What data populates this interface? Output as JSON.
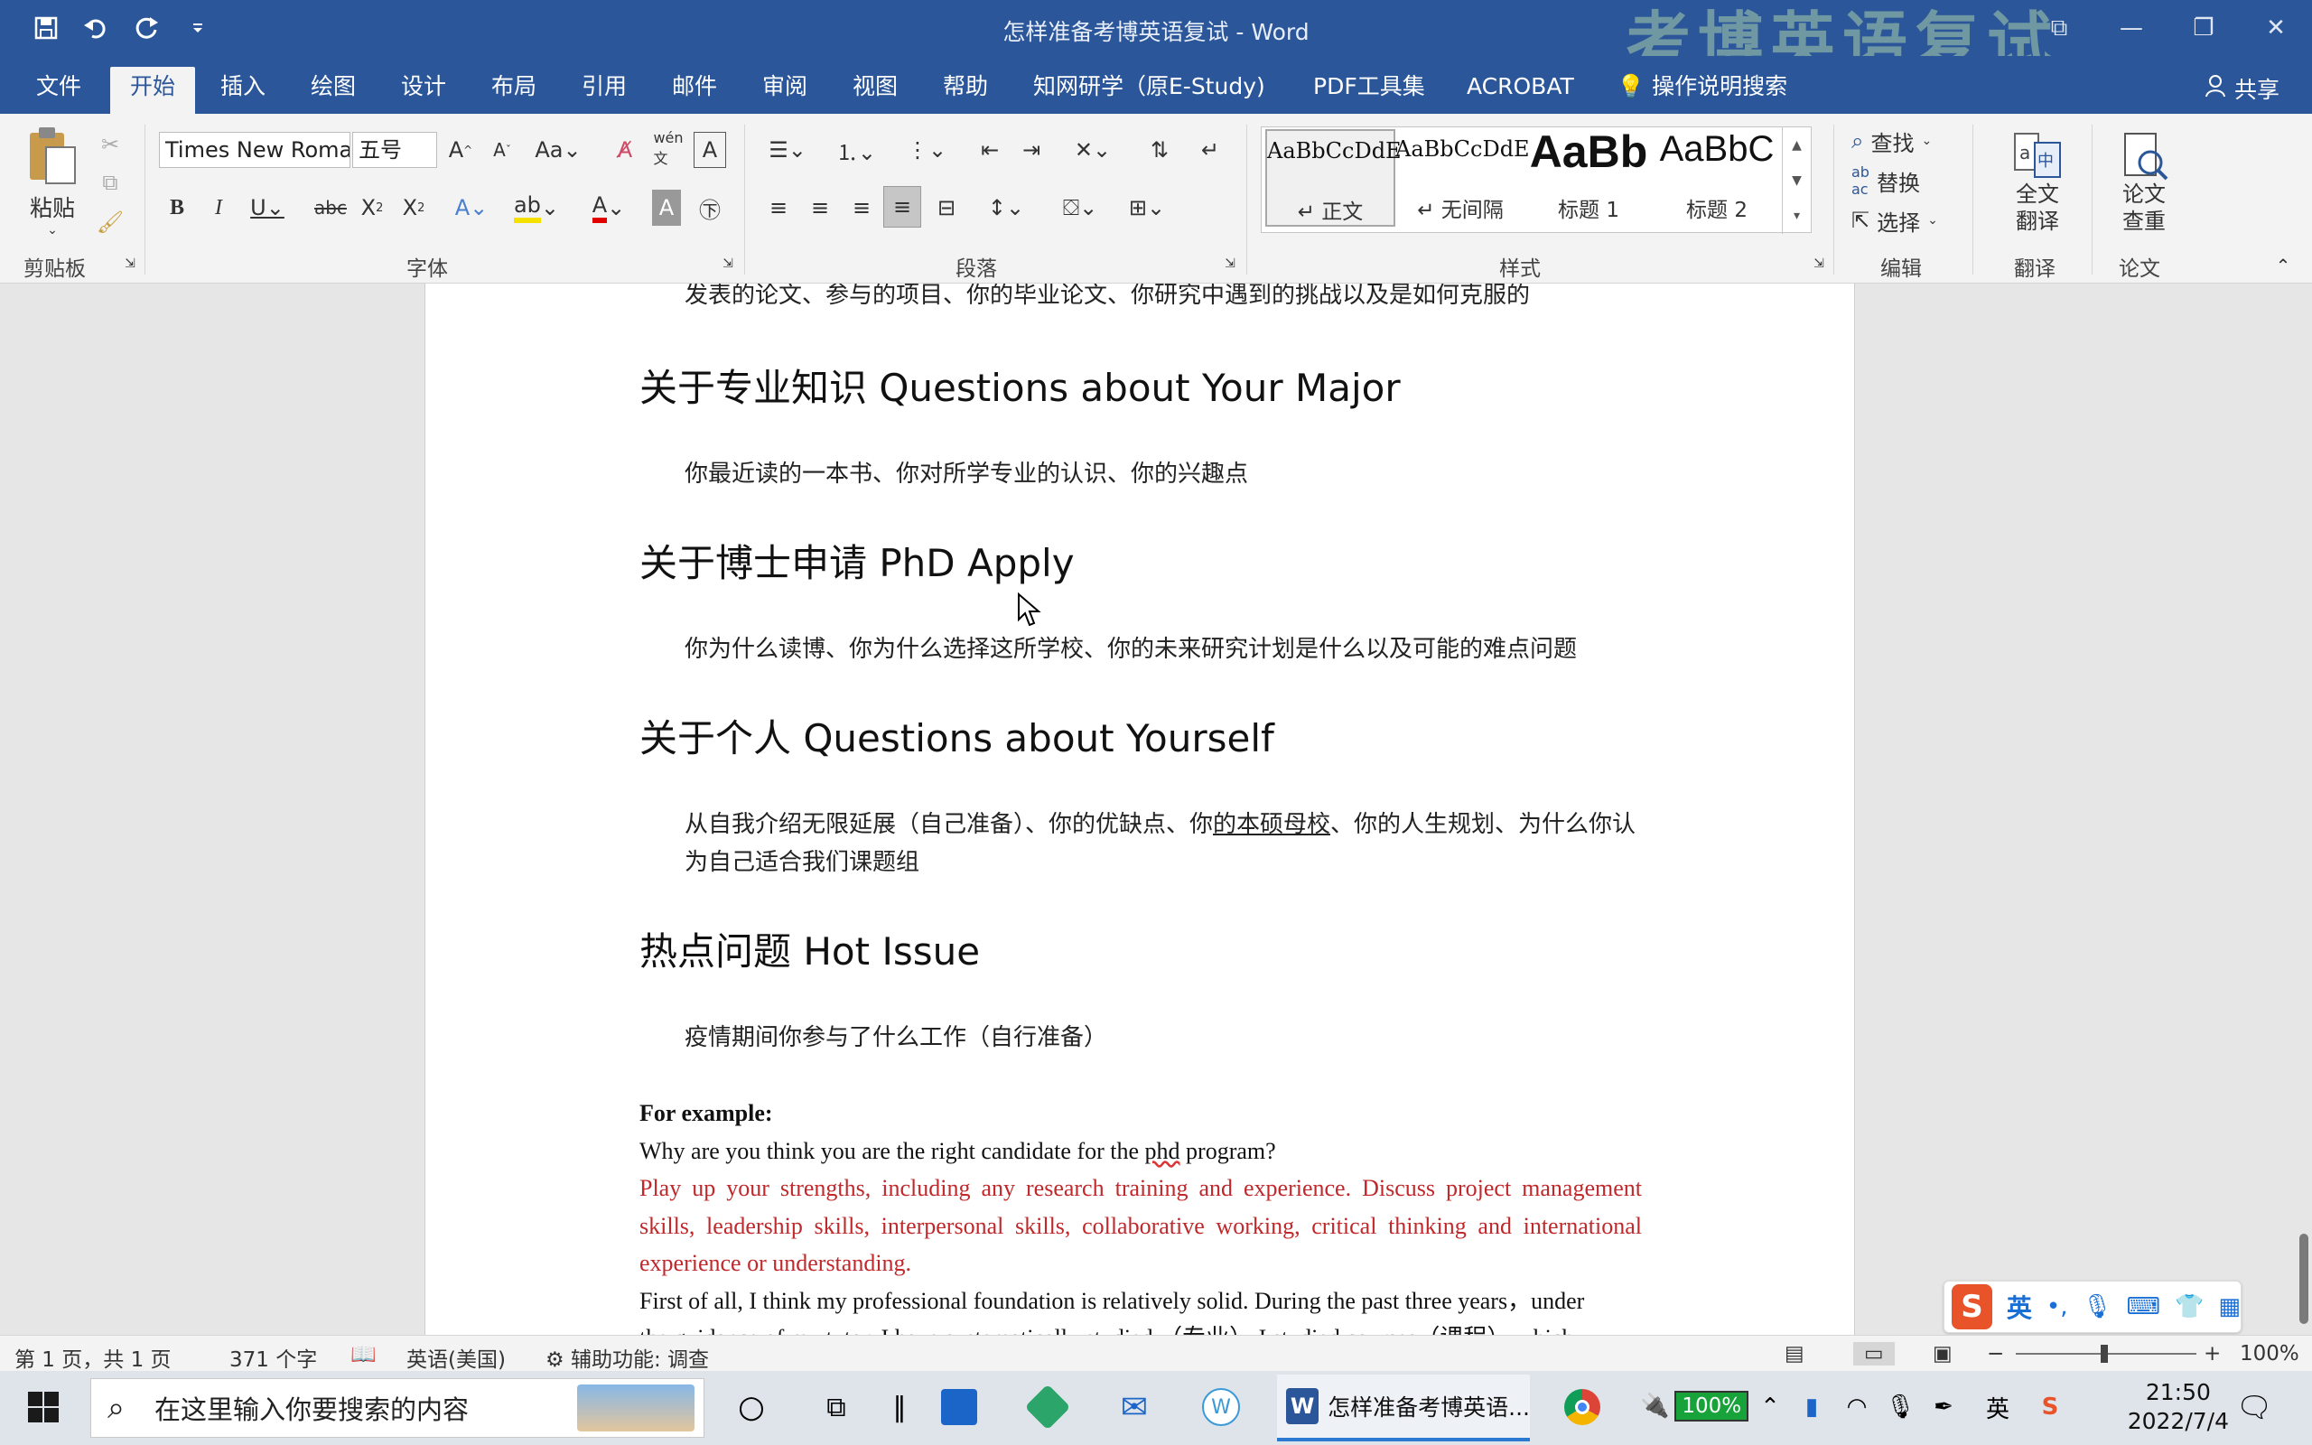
{
  "titlebar": {
    "title": "怎样准备考博英语复试  -  Word",
    "watermark": "考博英语复试"
  },
  "tabs": [
    {
      "label": "文件"
    },
    {
      "label": "开始"
    },
    {
      "label": "插入"
    },
    {
      "label": "绘图"
    },
    {
      "label": "设计"
    },
    {
      "label": "布局"
    },
    {
      "label": "引用"
    },
    {
      "label": "邮件"
    },
    {
      "label": "审阅"
    },
    {
      "label": "视图"
    },
    {
      "label": "帮助"
    },
    {
      "label": "知网研学（原E-Study)"
    },
    {
      "label": "PDF工具集"
    },
    {
      "label": "ACROBAT"
    },
    {
      "label": "操作说明搜索"
    }
  ],
  "share_label": "共享",
  "ribbon": {
    "paste_label": "粘贴",
    "clipboard_label": "剪贴板",
    "font_name": "Times New Roman",
    "font_size": "五号",
    "font_group_label": "字体",
    "paragraph_group_label": "段落",
    "styles_group_label": "样式",
    "styles": [
      {
        "preview": "AaBbCcDdE",
        "label": "↵ 正文"
      },
      {
        "preview": "AaBbCcDdE",
        "label": "↵ 无间隔"
      },
      {
        "preview": "AaBb",
        "label": "标题 1"
      },
      {
        "preview": "AaBbC",
        "label": "标题 2"
      }
    ],
    "find_label": "查找",
    "replace_label": "替换",
    "select_label": "选择",
    "editing_group_label": "编辑",
    "translate_full_label": "全文\n翻译",
    "translate_group_label": "翻译",
    "paper_check_label": "论文\n查重",
    "paper_group_label": "论文"
  },
  "document": {
    "top_line": "发表的论文、参与的项目、你的毕业论文、你研究中遇到的挑战以及是如何克服的",
    "sections": [
      {
        "heading": "关于专业知识 Questions about Your Major",
        "body": "你最近读的一本书、你对所学专业的认识、你的兴趣点"
      },
      {
        "heading": "关于博士申请 PhD Apply",
        "body": "你为什么读博、你为什么选择这所学校、你的未来研究计划是什么以及可能的难点问题"
      },
      {
        "heading": "关于个人 Questions about Yourself",
        "body_a": "从自我介绍无限延展（自己准备）、你的优缺点、你",
        "body_u": "的本硕母校",
        "body_b": "、你的人生规划、为什么你认为自己适合我们课题组"
      },
      {
        "heading": "热点问题 Hot Issue",
        "body": "疫情期间你参与了什么工作（自行准备）"
      }
    ],
    "example_label": "For example:",
    "question_a": "Why are you think you are the right candidate for the ",
    "question_phd": "phd",
    "question_b": " program?",
    "red_paragraph": "Play up your strengths, including any research training and experience. Discuss project management skills, leadership skills, interpersonal skills, collaborative working, critical thinking and international experience or understanding.",
    "last_line": "First of all, I think my professional foundation is relatively solid. During the past three years，under",
    "cut_line": "the guidance of my tutor, I have systematically studied （专业） I studied courses（课程） which"
  },
  "statusbar": {
    "page": "第 1 页，共 1 页",
    "words": "371 个字",
    "language": "英语(美国)",
    "accessibility": "辅助功能: 调查",
    "zoom": "100%",
    "zoom_level": 1.0
  },
  "ime": {
    "mode": "英"
  },
  "taskbar": {
    "search_placeholder": "在这里输入你要搜索的内容",
    "word_task": "怎样准备考博英语...",
    "battery": "100%",
    "lang": "英",
    "time": "21:50",
    "date": "2022/7/4"
  }
}
